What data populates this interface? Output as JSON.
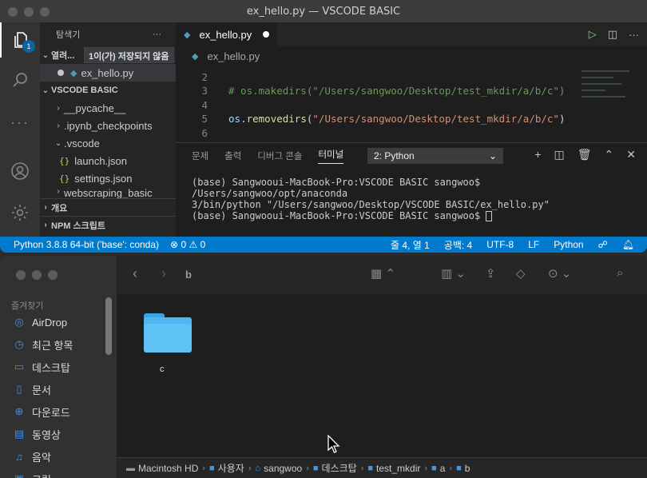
{
  "vscode": {
    "window_title": "ex_hello.py — VSCODE BASIC",
    "explorer_title": "탐색기",
    "explorer_more": "···",
    "open_editors_label": "열려...",
    "unsaved_tooltip": "1이(가) 저장되지 않음",
    "open_file": "ex_hello.py",
    "workspace": "VSCODE BASIC",
    "tree": [
      "__pycache__",
      ".ipynb_checkpoints",
      ".vscode",
      "launch.json",
      "settings.json",
      "webscraping_basic"
    ],
    "outline": "개요",
    "npm_scripts": "NPM 스크립트",
    "tab_label": "ex_hello.py",
    "breadcrumb": "ex_hello.py",
    "badge_count": "1",
    "code": {
      "line_numbers": [
        "2",
        "3",
        "4",
        "5",
        "6"
      ],
      "comment": "# os.makedirs(\"/Users/sangwoo/Desktop/test_mkdir/a/b/c\")",
      "call_obj": "os",
      "call_fn": "removedirs",
      "call_arg": "\"/Users/sangwoo/Desktop/test_mkdir/a/b/c\""
    },
    "panel_tabs": [
      "문제",
      "출력",
      "디버그 콘솔",
      "터미널"
    ],
    "terminal_select": "2: Python",
    "terminal_lines": [
      "(base) Sangwooui-MacBook-Pro:VSCODE BASIC sangwoo$ /Users/sangwoo/opt/anaconda",
      "3/bin/python \"/Users/sangwoo/Desktop/VSCODE BASIC/ex_hello.py\"",
      "(base) Sangwooui-MacBook-Pro:VSCODE BASIC sangwoo$ "
    ],
    "status": {
      "interpreter": "Python 3.8.8 64-bit ('base': conda)",
      "errors": "0",
      "warnings": "0",
      "position": "줄 4, 열 1",
      "spaces": "공백: 4",
      "encoding": "UTF-8",
      "eol": "LF",
      "language": "Python"
    }
  },
  "finder": {
    "current_folder": "b",
    "favorites_label": "즐겨찾기",
    "sidebar_items": [
      "AirDrop",
      "최근 항목",
      "데스크탑",
      "문서",
      "다운로드",
      "동영상",
      "음악",
      "그림"
    ],
    "items": [
      {
        "name": "c",
        "kind": "folder"
      }
    ],
    "path": [
      "Macintosh HD",
      "사용자",
      "sangwoo",
      "데스크탑",
      "test_mkdir",
      "a",
      "b"
    ]
  }
}
